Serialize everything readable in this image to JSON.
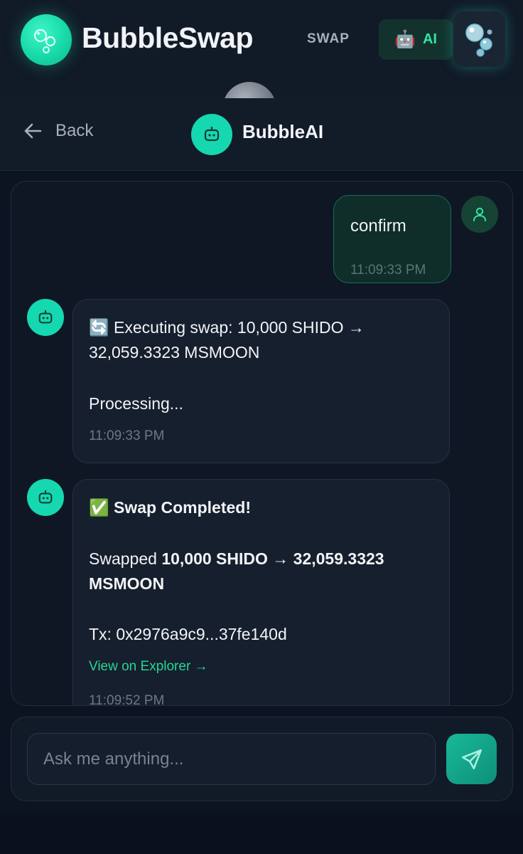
{
  "header": {
    "app_title": "BubbleSwap",
    "nav_swap": "SWAP",
    "nav_ai_label": "AI",
    "nav_ai_emoji": "🤖",
    "logo_icon": "bubbles-icon",
    "wallet_icon": "bubbles-icon"
  },
  "chat_header": {
    "back_label": "Back",
    "title": "BubbleAI"
  },
  "messages": [
    {
      "role": "user",
      "text": "confirm",
      "timestamp": "11:09:33 PM"
    },
    {
      "role": "bot",
      "line1": "🔄 Executing swap: 10,000 SHIDO →",
      "line2": "32,059.3323 MSMOON",
      "line3": "Processing...",
      "timestamp": "11:09:33 PM"
    },
    {
      "role": "bot",
      "heading_emoji": "✅",
      "heading": "Swap Completed!",
      "swapped_prefix": "Swapped ",
      "swapped_amounts": "10,000 SHIDO → 32,059.3323",
      "swapped_token": "MSMOON",
      "tx": "Tx: 0x2976a9c9...37fe140d",
      "explorer_link": "View on Explorer →",
      "timestamp": "11:09:52 PM"
    }
  ],
  "input": {
    "placeholder": "Ask me anything...",
    "value": ""
  },
  "colors": {
    "accent": "#16d8b0",
    "link": "#27d597",
    "background": "#0d1421"
  }
}
